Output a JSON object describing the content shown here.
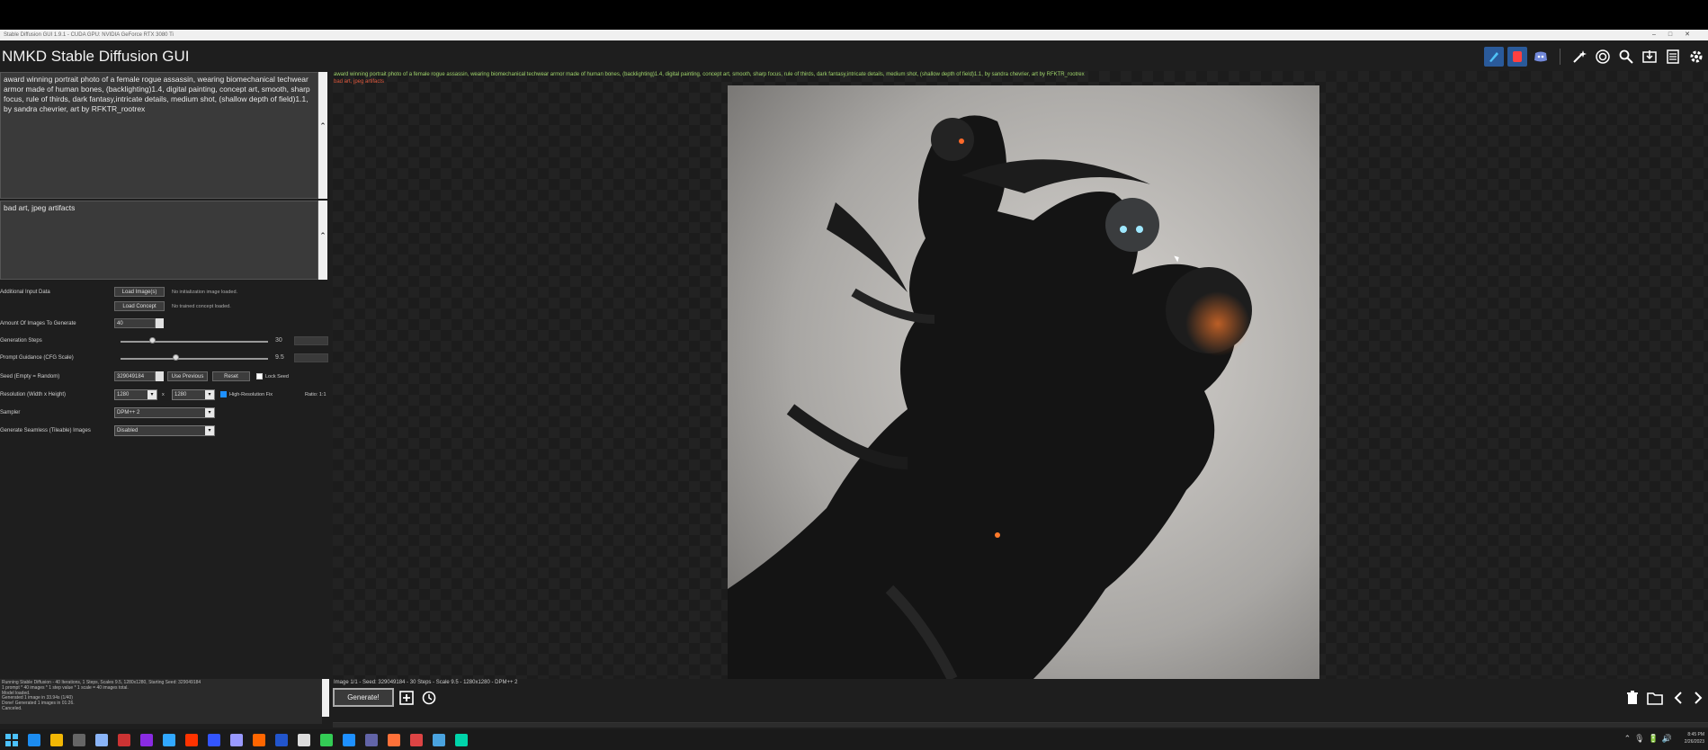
{
  "window": {
    "titlebar_text": "Stable Diffusion GUI 1.9.1 - CUDA GPU: NVIDIA GeForce RTX 3080 Ti",
    "app_title": "NMKD Stable Diffusion GUI"
  },
  "toolbar": {
    "icons": [
      "paint-brush-icon",
      "record-icon",
      "discord-icon",
      "magic-wand-icon",
      "target-icon",
      "search-icon",
      "download-icon",
      "list-icon",
      "gear-icon"
    ]
  },
  "prompt": {
    "positive": "award winning portrait photo of a female rogue assassin, wearing biomechanical techwear armor made of human bones, (backlighting)1.4, digital painting, concept art, smooth, sharp focus, rule of thirds, dark fantasy,intricate details, medium shot, (shallow depth of field)1.1, by sandra chevrier, art by RFKTR_rootrex",
    "negative": "bad art, jpeg artifacts"
  },
  "settings": {
    "additional_input_label": "Additional Input Data",
    "load_images_label": "Load Image(s)",
    "no_init_image_text": "No initialization image loaded.",
    "load_concept_label": "Load Concept",
    "no_concept_text": "No trained concept loaded.",
    "amount_label": "Amount Of Images To Generate",
    "amount_value": "40",
    "steps_label": "Generation Steps",
    "steps_value": "30",
    "steps_fraction": 0.22,
    "guidance_label": "Prompt Guidance (CFG Scale)",
    "guidance_value": "9.5",
    "guidance_fraction": 0.38,
    "seed_label": "Seed (Empty = Random)",
    "seed_value": "329049184",
    "use_previous_label": "Use Previous",
    "reset_label": "Reset",
    "lock_seed_label": "Lock Seed",
    "resolution_label": "Resolution (Width x Height)",
    "width_value": "1280",
    "x_label": "x",
    "height_value": "1280",
    "hires_label": "High-Resolution Fix",
    "ratio_text": "Ratio: 1:1",
    "sampler_label": "Sampler",
    "sampler_value": "DPM++ 2",
    "seamless_label": "Generate Seamless (Tileable) Images",
    "seamless_value": "Disabled"
  },
  "output": {
    "prompt_line": "award winning portrait photo of a female rogue assassin, wearing biomechanical techwear armor made of human bones, (backlighting)1.4, digital painting, concept art, smooth, sharp focus, rule of thirds, dark fantasy,intricate details, medium shot, (shallow depth of field)1.1, by sandra chevrier, art by RFKTR_rootrex",
    "negative_line": "bad art, jpeg artifacts",
    "image_info": "Image 1/1 - Seed: 329049184 - 30 Steps - Scale 9.5 - 1280x1280 - DPM++ 2"
  },
  "log": {
    "lines": [
      "Running Stable Diffusion - 40 Iterations, 1 Steps, Scales 9.5, 1280x1280, Starting Seed: 329049184",
      "1 prompt * 40 images * 1 step value * 1 scale = 40 images total.",
      "Model loaded.",
      "Generated 1 image in 33.94s (1/40)",
      "Done! Generated 1 images in 01:26.",
      "Canceled."
    ]
  },
  "bottom": {
    "generate_label": "Generate!",
    "icons": [
      "add-icon",
      "history-icon",
      "trash-icon",
      "folder-icon",
      "chevron-left-icon",
      "chevron-right-icon"
    ]
  },
  "taskbar": {
    "time": "8:45 PM",
    "date": "2/26/2023",
    "apps": [
      "#1c8cf0",
      "#f2b705",
      "#666666",
      "#8ab4f8",
      "#cc3333",
      "#8a2be2",
      "#31a8ff",
      "#ff3300",
      "#3355ff",
      "#9999ff",
      "#ff6600",
      "#2255cc",
      "#dddddd",
      "#33cc55",
      "#1e90ff",
      "#6264a7",
      "#ff7139",
      "#dd4444",
      "#4aa3df",
      "#00d4aa"
    ]
  }
}
